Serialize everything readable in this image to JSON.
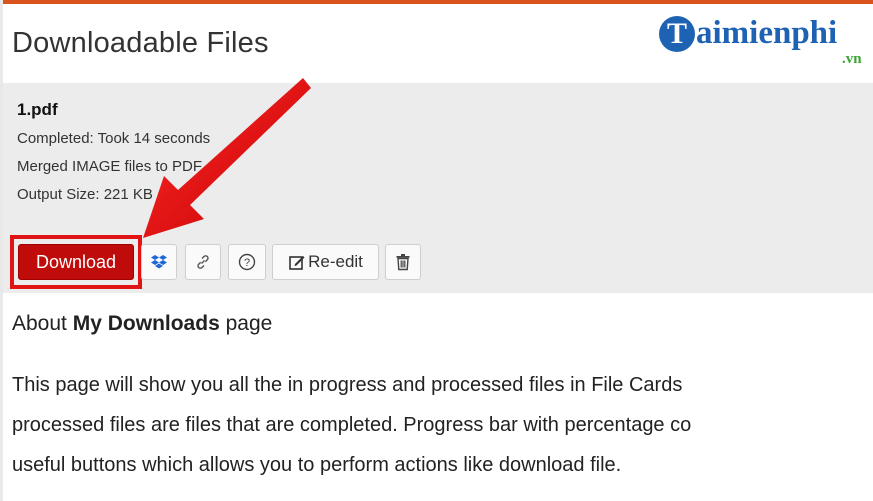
{
  "header": {
    "title": "Downloadable Files"
  },
  "logo": {
    "mark": "T",
    "name": "aimienphi",
    "suffix": ".vn"
  },
  "file_card": {
    "file_name": "1.pdf",
    "status": "Completed: Took 14 seconds",
    "operation": "Merged IMAGE files to PDF",
    "output_size": "Output Size: 221 KB",
    "actions": {
      "download_label": "Download",
      "dropbox_icon": "dropbox-icon",
      "link_icon": "link-icon",
      "help_icon": "help-icon",
      "reedit_label": "Re-edit",
      "trash_icon": "trash-icon"
    }
  },
  "about": {
    "prefix": "About",
    "bold": "My Downloads",
    "suffix": "page",
    "lines": [
      "This page will show you all the in progress and processed files in File Cards",
      "processed files are files that are completed. Progress bar with percentage co",
      "useful buttons which allows you to perform actions like download file."
    ]
  },
  "colors": {
    "accent_line": "#d9531e",
    "download_button": "#c00b0b",
    "highlight": "#e01414",
    "logo_blue": "#1e63b3",
    "logo_green": "#3aa534"
  }
}
